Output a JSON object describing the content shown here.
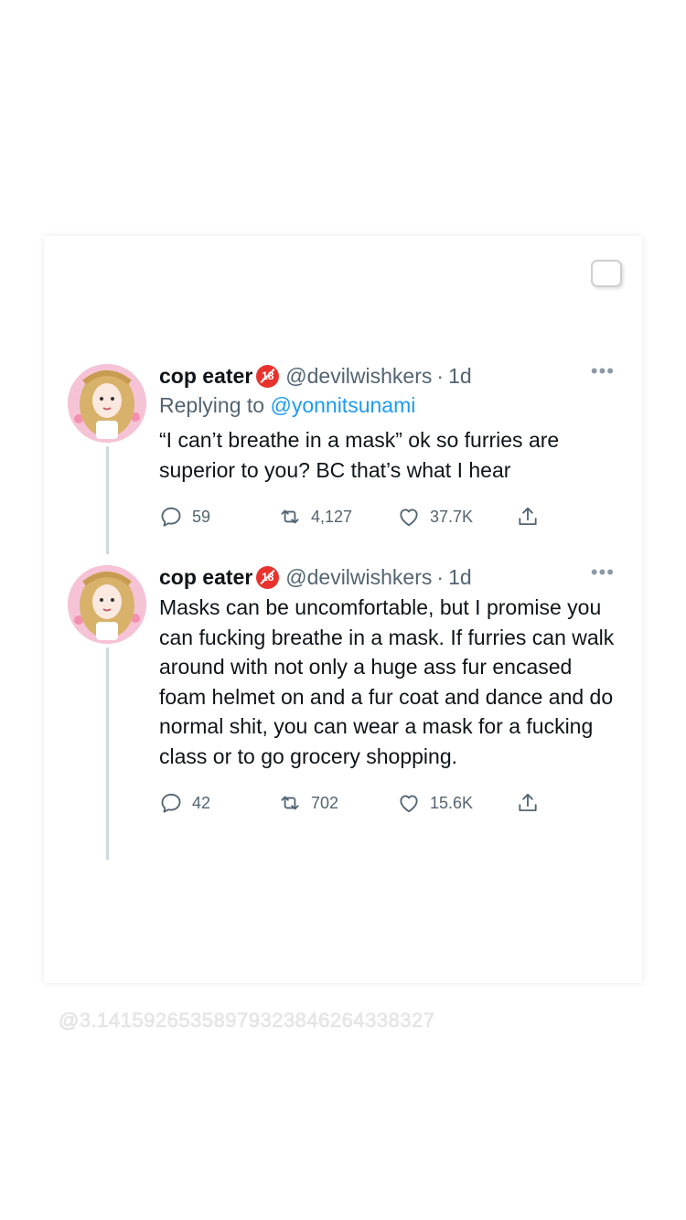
{
  "tweets": [
    {
      "name": "cop eater",
      "badge_text": "18",
      "handle": "@devilwishkers",
      "separator": "·",
      "time": "1d",
      "reply_prefix": "Replying to ",
      "reply_handle": "@yonnitsunami",
      "text": "“I can’t breathe in a mask” ok so furries are superior to you? BC that’s what I hear",
      "replies": "59",
      "retweets": "4,127",
      "likes": "37.7K"
    },
    {
      "name": "cop eater",
      "badge_text": "18",
      "handle": "@devilwishkers",
      "separator": "·",
      "time": "1d",
      "text": "Masks can be uncomfortable, but I promise you can fucking breathe in a mask. If furries can walk around with not only a huge ass fur encased foam helmet on and a fur coat and dance and do normal shit, you can wear a mask for a fucking class or to go grocery shopping.",
      "replies": "42",
      "retweets": "702",
      "likes": "15.6K"
    }
  ],
  "more_glyph": "•••",
  "watermark": "@3.14159265358979323846264338327",
  "colors": {
    "text": "#0f1419",
    "secondary": "#536471",
    "link": "#1d9bf0",
    "thread_line": "#cfd9de",
    "badge": "#e8322d"
  }
}
